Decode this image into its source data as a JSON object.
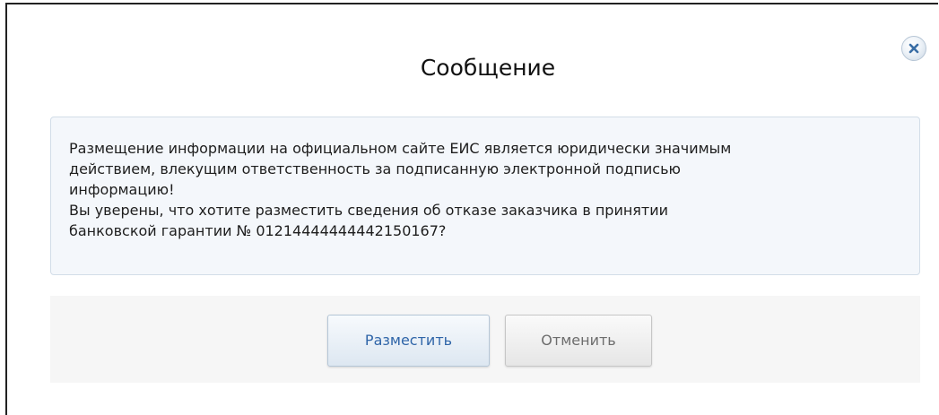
{
  "dialog": {
    "title": "Сообщение",
    "close_icon": "close-icon",
    "message": {
      "line1": "Размещение информации на официальном сайте ЕИС является юридически значимым",
      "line2": "действием, влекущим ответственность за подписанную электронной подписью",
      "line3": "информацию!",
      "line4": "Вы уверены, что хотите разместить сведения об отказе заказчика в принятии",
      "line5": "банковской гарантии № 01214444444442150167?"
    },
    "buttons": {
      "submit_label": "Разместить",
      "cancel_label": "Отменить"
    }
  },
  "colors": {
    "primary_text": "#2f65a8",
    "message_bg": "#f4f7fb",
    "footer_bg": "#f6f6f6"
  }
}
